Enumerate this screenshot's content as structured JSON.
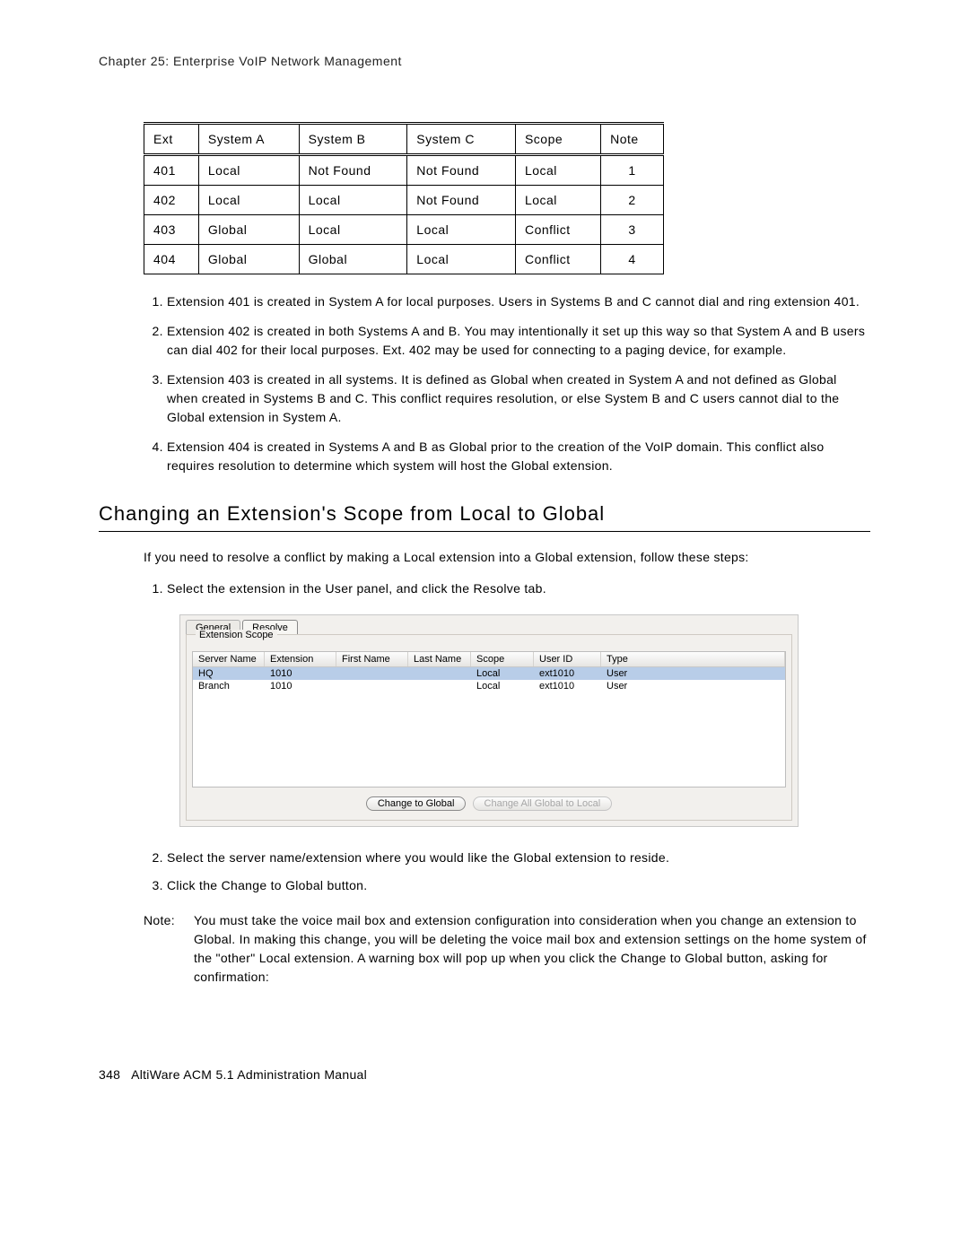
{
  "header": {
    "chapter_line": "Chapter 25:  Enterprise VoIP Network Management"
  },
  "table": {
    "headers": [
      "Ext",
      "System A",
      "System B",
      "System C",
      "Scope",
      "Note"
    ],
    "rows": [
      {
        "ext": "401",
        "a": "Local",
        "b": "Not Found",
        "c": "Not Found",
        "scope": "Local",
        "note": "1"
      },
      {
        "ext": "402",
        "a": "Local",
        "b": "Local",
        "c": "Not Found",
        "scope": "Local",
        "note": "2"
      },
      {
        "ext": "403",
        "a": "Global",
        "b": "Local",
        "c": "Local",
        "scope": "Conflict",
        "note": "3"
      },
      {
        "ext": "404",
        "a": "Global",
        "b": "Global",
        "c": "Local",
        "scope": "Conflict",
        "note": "4"
      }
    ]
  },
  "notes_list": {
    "n1": "Extension 401 is created in System A for local purposes. Users in Systems B and C cannot dial and ring extension 401.",
    "n2": "Extension 402 is created in both Systems A and B. You may intentionally it set up this way so that System A and B users can dial 402 for their local purposes. Ext. 402 may be used for connecting to a paging device, for example.",
    "n3": "Extension 403 is created in all systems. It is defined as Global when created in System A and not defined as Global when created in Systems B and C. This conflict requires resolution, or else System B and C users cannot dial to the Global extension in System A.",
    "n4": "Extension 404 is created in Systems A and B as Global prior to the creation of the VoIP domain. This conflict also requires resolution to determine which system will host the Global extension."
  },
  "section": {
    "title": "Changing an Extension's Scope from Local to Global",
    "intro": "If you need to resolve a conflict by making a Local extension into a Global extension, follow these steps:",
    "step1": "Select the extension in the User panel, and click the Resolve tab.",
    "step2": "Select the server name/extension where you would like the Global extension to reside.",
    "step3": "Click the Change to Global button.",
    "note_label": "Note:",
    "note_text": "You must take the voice mail box and extension configuration into consideration when you change an extension to Global. In making this change, you will be deleting the voice mail box and extension settings on the home system of the \"other\" Local extension. A warning box will pop up when you click the Change to Global button, asking for confirmation:"
  },
  "panel": {
    "tabs": {
      "general": "General",
      "resolve": "Resolve"
    },
    "group_label": "Extension Scope",
    "columns": {
      "server": "Server Name",
      "ext": "Extension",
      "first": "First Name",
      "last": "Last Name",
      "scope": "Scope",
      "userid": "User ID",
      "type": "Type"
    },
    "rows": [
      {
        "server": "HQ",
        "ext": "1010",
        "first": "",
        "last": "",
        "scope": "Local",
        "userid": "ext1010",
        "type": "User",
        "selected": true
      },
      {
        "server": "Branch",
        "ext": "1010",
        "first": "",
        "last": "",
        "scope": "Local",
        "userid": "ext1010",
        "type": "User",
        "selected": false
      }
    ],
    "buttons": {
      "change_to_global": "Change to Global",
      "change_all_global_to_local": "Change All Global to Local"
    }
  },
  "footer": {
    "page": "348",
    "title": "AltiWare ACM 5.1 Administration Manual"
  }
}
